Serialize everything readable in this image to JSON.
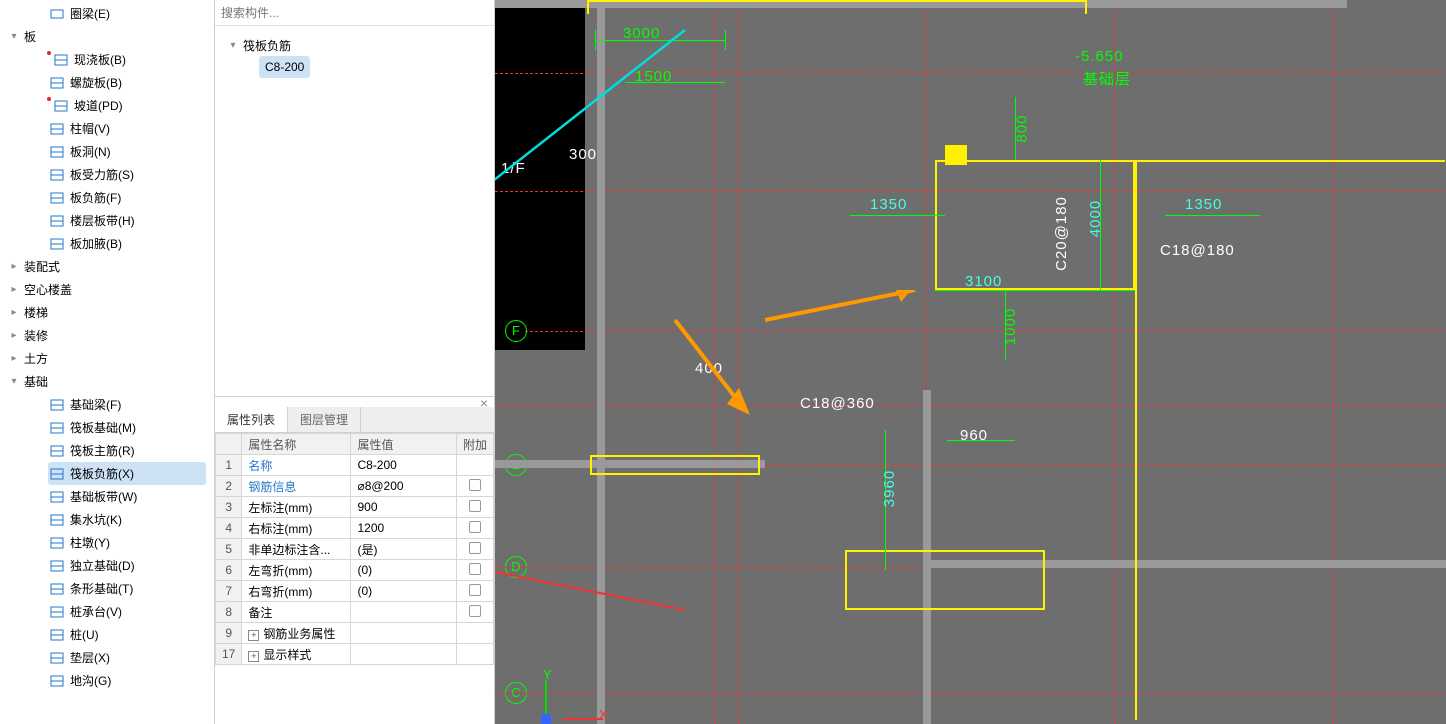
{
  "left_tree": {
    "beam_group": {
      "label": "圈梁(E)"
    },
    "board": {
      "label": "板",
      "items": [
        {
          "label": "现浇板(B)",
          "dot": true
        },
        {
          "label": "螺旋板(B)"
        },
        {
          "label": "坡道(PD)",
          "dot": true
        },
        {
          "label": "柱帽(V)"
        },
        {
          "label": "板洞(N)"
        },
        {
          "label": "板受力筋(S)"
        },
        {
          "label": "板负筋(F)"
        },
        {
          "label": "楼层板带(H)"
        },
        {
          "label": "板加腋(B)"
        }
      ]
    },
    "groups": [
      {
        "label": "装配式"
      },
      {
        "label": "空心楼盖"
      },
      {
        "label": "楼梯"
      },
      {
        "label": "装修"
      },
      {
        "label": "土方"
      }
    ],
    "foundation": {
      "label": "基础",
      "items": [
        {
          "label": "基础梁(F)"
        },
        {
          "label": "筏板基础(M)"
        },
        {
          "label": "筏板主筋(R)"
        },
        {
          "label": "筏板负筋(X)",
          "selected": true
        },
        {
          "label": "基础板带(W)"
        },
        {
          "label": "集水坑(K)"
        },
        {
          "label": "柱墩(Y)"
        },
        {
          "label": "独立基础(D)"
        },
        {
          "label": "条形基础(T)"
        },
        {
          "label": "桩承台(V)"
        },
        {
          "label": "桩(U)"
        },
        {
          "label": "垫层(X)"
        },
        {
          "label": "地沟(G)"
        }
      ]
    }
  },
  "mid": {
    "search_placeholder": "搜索构件...",
    "tree": {
      "root": "筏板负筋",
      "child": "C8-200"
    },
    "tabs": {
      "prop": "属性列表",
      "layer": "图层管理"
    },
    "grid": {
      "header": {
        "name": "属性名称",
        "val": "属性值",
        "chk": "附加"
      },
      "rows": [
        {
          "n": "1",
          "name": "名称",
          "val": "C8-200",
          "blue": true
        },
        {
          "n": "2",
          "name": "钢筋信息",
          "val": "⌀8@200",
          "blue": true,
          "chk": true
        },
        {
          "n": "3",
          "name": "左标注(mm)",
          "val": "900",
          "chk": true
        },
        {
          "n": "4",
          "name": "右标注(mm)",
          "val": "1200",
          "chk": true
        },
        {
          "n": "5",
          "name": "非单边标注含...",
          "val": "(是)",
          "chk": true
        },
        {
          "n": "6",
          "name": "左弯折(mm)",
          "val": "(0)",
          "chk": true
        },
        {
          "n": "7",
          "name": "右弯折(mm)",
          "val": "(0)",
          "chk": true
        },
        {
          "n": "8",
          "name": "备注",
          "val": "",
          "chk": true
        },
        {
          "n": "9",
          "name": "钢筋业务属性",
          "plus": true
        },
        {
          "n": "17",
          "name": "显示样式",
          "plus": true
        }
      ]
    }
  },
  "canvas": {
    "dims": {
      "d3000": "3000",
      "d1500": "1500",
      "d300": "300",
      "d400": "400",
      "d1350a": "1350",
      "d1350b": "1350",
      "d3100": "3100",
      "d4000": "4000",
      "d800": "800",
      "d1000": "1000",
      "d960": "960",
      "d3960": "3960",
      "c20": "C20@180",
      "c18a": "C18@180",
      "c18b": "C18@360",
      "minus": "-5.650",
      "basement": "基础层"
    },
    "markers": [
      "E",
      "F",
      "D",
      "C"
    ],
    "floor": "1/F"
  }
}
